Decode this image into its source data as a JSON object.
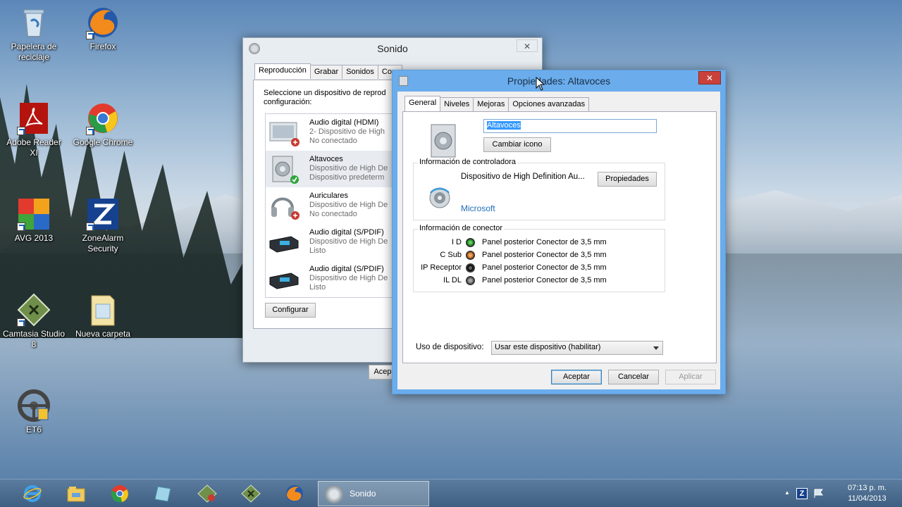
{
  "desktop": {
    "icons": [
      {
        "label": "Papelera de reciclaje"
      },
      {
        "label": "Firefox"
      },
      {
        "label": "Adobe Reader XI"
      },
      {
        "label": "Google Chrome"
      },
      {
        "label": "AVG 2013"
      },
      {
        "label": "ZoneAlarm Security"
      },
      {
        "label": "Camtasia Studio 8"
      },
      {
        "label": "Nueva carpeta"
      },
      {
        "label": "ET6"
      }
    ]
  },
  "sound_window": {
    "title": "Sonido",
    "close_glyph": "✕",
    "tabs": [
      "Reproducción",
      "Grabar",
      "Sonidos",
      "Com"
    ],
    "instruction_line1": "Seleccione un dispositivo de reprod",
    "instruction_line2": "configuración:",
    "devices": [
      {
        "name": "Audio digital (HDMI)",
        "sub": "2- Dispositivo de High",
        "status": "No conectado",
        "icon": "monitor-icon",
        "badge": "disconnected"
      },
      {
        "name": "Altavoces",
        "sub": "Dispositivo de High De",
        "status": "Dispositivo predeterm",
        "icon": "speaker-icon",
        "badge": "default"
      },
      {
        "name": "Auriculares",
        "sub": "Dispositivo de High De",
        "status": "No conectado",
        "icon": "headphones-icon",
        "badge": "disconnected"
      },
      {
        "name": "Audio digital (S/PDIF)",
        "sub": "Dispositivo de High De",
        "status": "Listo",
        "icon": "spdif-receiver-icon",
        "badge": ""
      },
      {
        "name": "Audio digital (S/PDIF)",
        "sub": "Dispositivo de High De",
        "status": "Listo",
        "icon": "spdif-receiver-icon",
        "badge": ""
      }
    ],
    "configure_label": "Configurar",
    "accept_partial": "Acep"
  },
  "properties_window": {
    "title": "Propiedades: Altavoces",
    "close_glyph": "✕",
    "tabs": [
      "General",
      "Niveles",
      "Mejoras",
      "Opciones avanzadas"
    ],
    "device_name_value": "Altavoces",
    "change_icon_label": "Cambiar icono",
    "controller_group_label": "Información de controladora",
    "controller_name": "Dispositivo de High Definition Au...",
    "controller_props_label": "Propiedades",
    "controller_vendor": "Microsoft",
    "connector_group_label": "Información de conector",
    "connectors": [
      {
        "label": "I D",
        "color": "#1fa81f",
        "text": "Panel posterior Conector de 3,5 mm"
      },
      {
        "label": "C Sub",
        "color": "#d9731a",
        "text": "Panel posterior Conector de 3,5 mm"
      },
      {
        "label": "IP Receptor",
        "color": "#111111",
        "text": "Panel posterior Conector de 3,5 mm"
      },
      {
        "label": "IL DL",
        "color": "#777777",
        "text": "Panel posterior Conector de 3,5 mm"
      }
    ],
    "usage_label": "Uso de dispositivo:",
    "usage_value": "Usar este dispositivo (habilitar)",
    "ok_label": "Aceptar",
    "cancel_label": "Cancelar",
    "apply_label": "Aplicar"
  },
  "taskbar": {
    "sound_label": "Sonido",
    "tray_up_glyph": "▲",
    "tray_za": "Z",
    "time": "07:13 p. m.",
    "date": "11/04/2013"
  }
}
